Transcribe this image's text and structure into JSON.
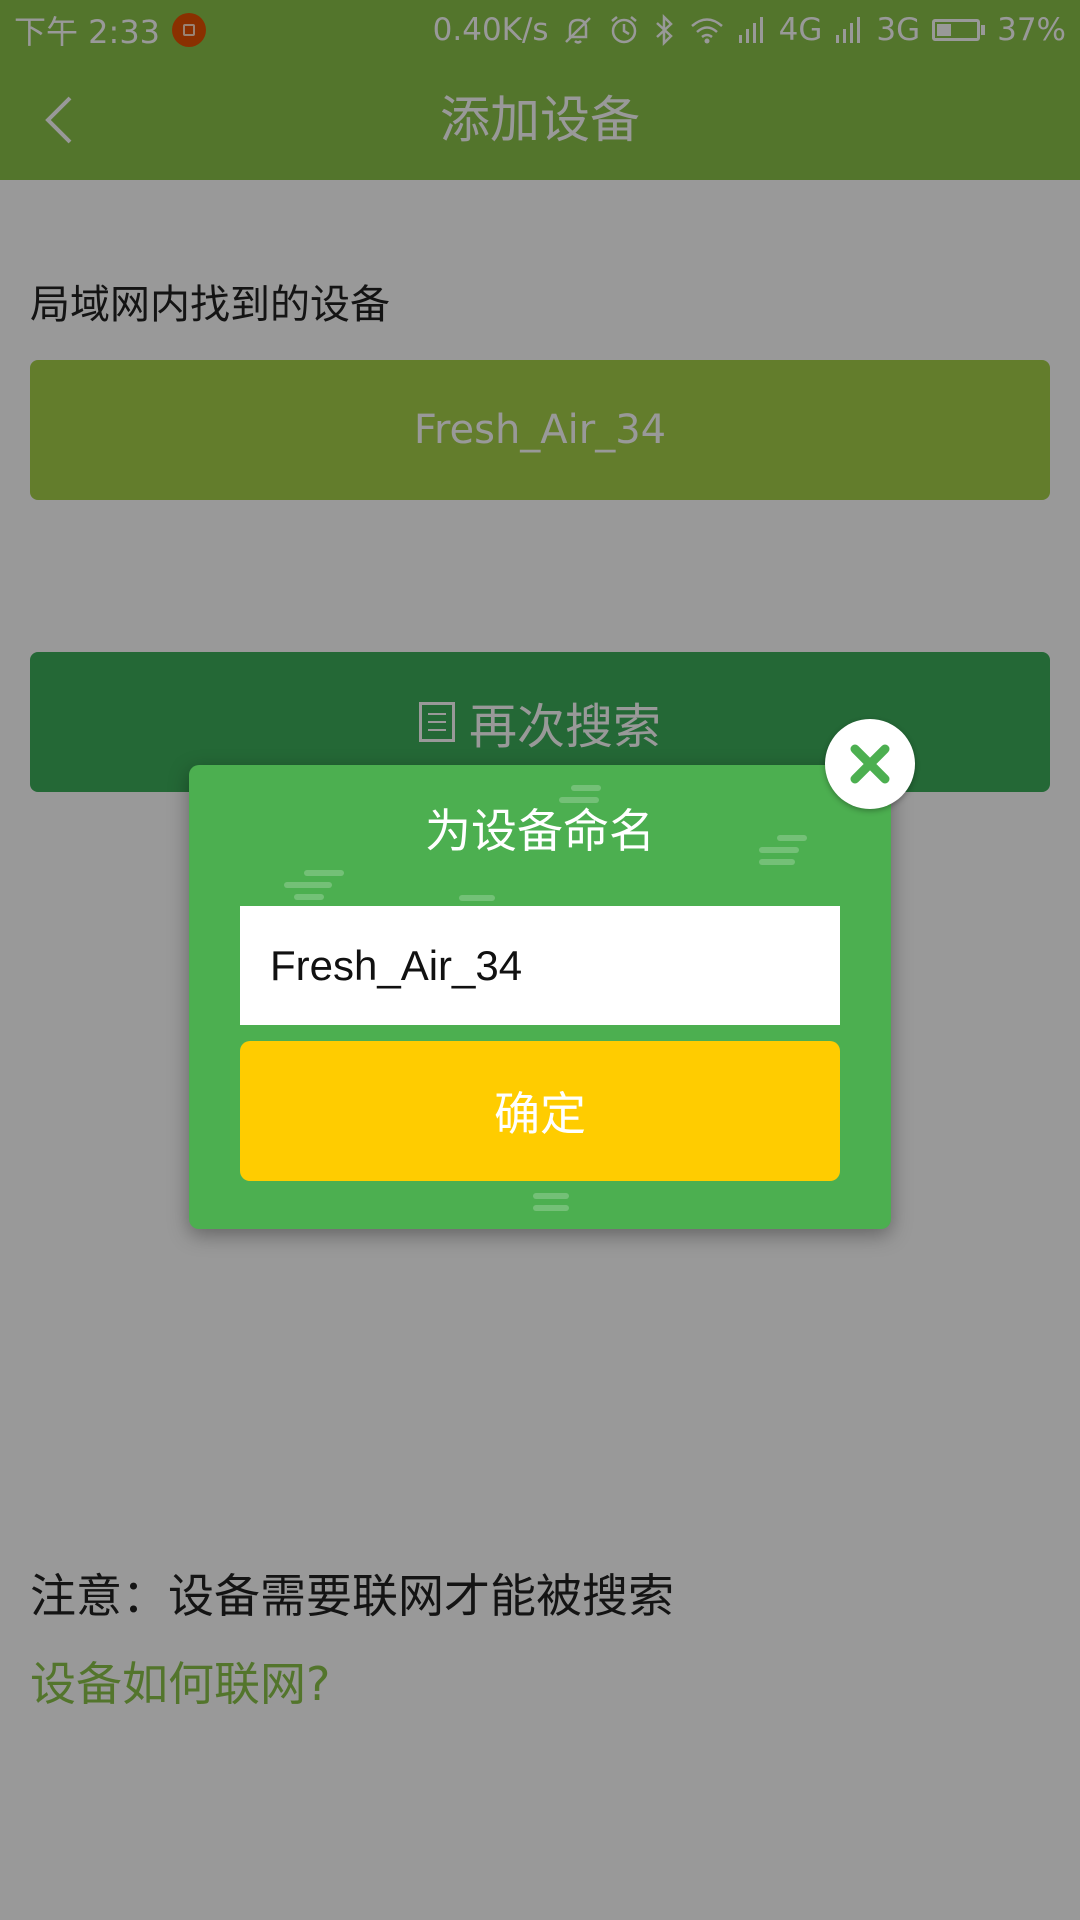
{
  "status_bar": {
    "time": "下午 2:33",
    "speed": "0.40K/s",
    "network_1": "4G",
    "network_2": "3G",
    "battery_level": 0.37,
    "battery_text": "37%",
    "notification_color": "#e65100"
  },
  "app_bar": {
    "title": "添加设备",
    "back_icon": "chevron-left-icon",
    "color": "#8bc34a"
  },
  "content": {
    "section_label": "局域网内找到的设备",
    "device_name": "Fresh_Air_34",
    "search_again_label": "再次搜索",
    "search_icon": "list-icon",
    "notice": "注意：设备需要联网才能被搜索",
    "help_link": "设备如何联网?"
  },
  "dialog": {
    "title": "为设备命名",
    "input_value": "Fresh_Air_34",
    "confirm_label": "确定",
    "close_icon": "close-icon",
    "colors": {
      "background": "#4caf50",
      "confirm": "#ffcc00",
      "close_x": "#4caf50"
    }
  }
}
